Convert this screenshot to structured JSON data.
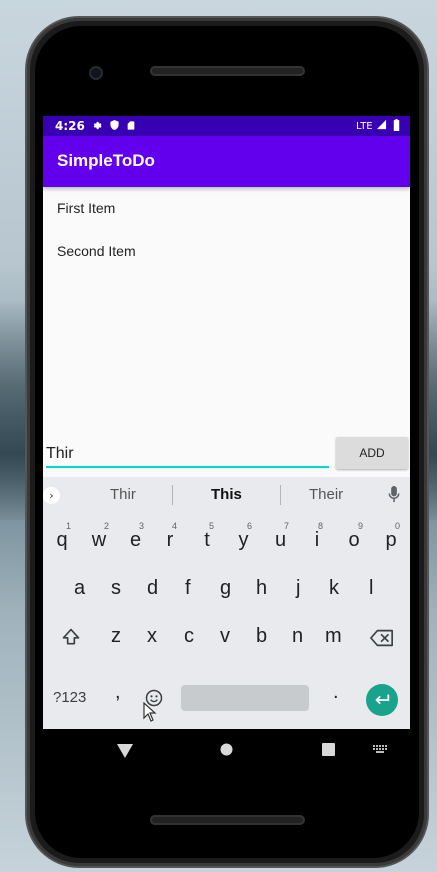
{
  "statusbar": {
    "time": "4:26",
    "network": "LTE"
  },
  "app": {
    "title": "SimpleToDo"
  },
  "list": {
    "items": [
      {
        "label": "First Item"
      },
      {
        "label": "Second Item"
      }
    ]
  },
  "input": {
    "value": "Thir",
    "add_label": "ADD"
  },
  "keyboard": {
    "suggestions": [
      "Thir",
      "This",
      "Their"
    ],
    "row1": [
      {
        "key": "q",
        "num": "1"
      },
      {
        "key": "w",
        "num": "2"
      },
      {
        "key": "e",
        "num": "3"
      },
      {
        "key": "r",
        "num": "4"
      },
      {
        "key": "t",
        "num": "5"
      },
      {
        "key": "y",
        "num": "6"
      },
      {
        "key": "u",
        "num": "7"
      },
      {
        "key": "i",
        "num": "8"
      },
      {
        "key": "o",
        "num": "9"
      },
      {
        "key": "p",
        "num": "0"
      }
    ],
    "row2": [
      "a",
      "s",
      "d",
      "f",
      "g",
      "h",
      "j",
      "k",
      "l"
    ],
    "row3": [
      "z",
      "x",
      "c",
      "v",
      "b",
      "n",
      "m"
    ],
    "row4": {
      "symbols": "?123",
      "comma": ",",
      "period": "."
    }
  },
  "colors": {
    "primary": "#6200ee",
    "primary_dark": "#3700b3",
    "accent": "#03dac5",
    "enter": "#1aa38b"
  },
  "icons": [
    "settings-icon",
    "shield-icon",
    "sim-card-icon",
    "signal-icon",
    "battery-icon",
    "mic-icon",
    "shift-icon",
    "backspace-icon",
    "emoji-icon",
    "enter-icon",
    "back-icon",
    "home-icon",
    "recents-icon",
    "keyboard-icon",
    "cursor-icon"
  ]
}
